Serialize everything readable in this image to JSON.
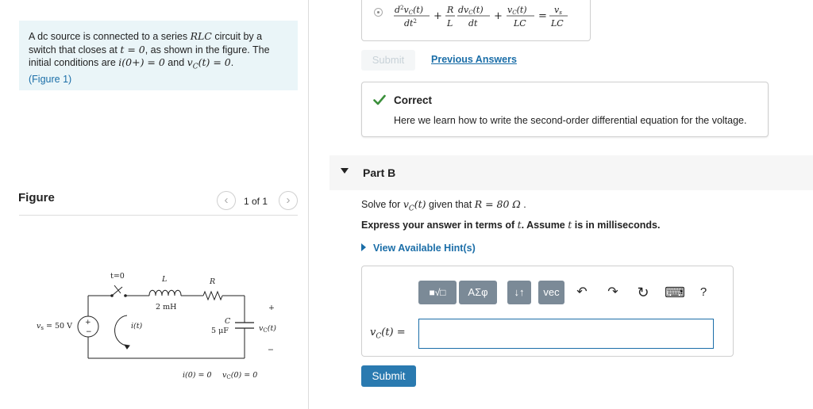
{
  "intro": {
    "line1_pre": "A dc source is connected to a series ",
    "line1_math": "RLC",
    "line1_post": " circuit by a",
    "line2_pre": "switch that closes at ",
    "line2_math": "t = 0",
    "line2_post": ", as shown in the figure. The",
    "line3_pre": "initial conditions are ",
    "line3_math1": "i(0+) = 0",
    "line3_mid": " and ",
    "line3_math2": "v",
    "line3_math2_sub": "C",
    "line3_math2_post": "(t) = 0",
    "line3_end": ".",
    "figure_link": "(Figure 1)"
  },
  "figure_panel": {
    "heading": "Figure",
    "counter": "1 of 1",
    "prev_glyph": "‹",
    "next_glyph": "›"
  },
  "circuit": {
    "switch_label": "t=0",
    "inductor_label": "L",
    "inductor_value": "2 mH",
    "resistor_label": "R",
    "capacitor_label": "C",
    "capacitor_value": "5 μF",
    "source_label": "v",
    "source_sub": "s",
    "source_value": " = 50 V",
    "current_label": "i(t)",
    "vc_label": "v",
    "vc_sub": "C",
    "vc_post": "(t)",
    "plus": "+",
    "minus": "−",
    "ic_text": "i(0) = 0",
    "vc0_pre": "v",
    "vc0_sub": "C",
    "vc0_post": "(0) = 0"
  },
  "previous_answer": {
    "eq_d2": "d",
    "eq_d2_exp": "2",
    "eq_vc": "v",
    "eq_vc_sub": "C",
    "eq_t": "(t)",
    "eq_dt2": "dt",
    "eq_dt2_exp": "2",
    "eq_plus": "+",
    "eq_R": "R",
    "eq_L": "L",
    "eq_dvc": "dv",
    "eq_dt": "dt",
    "eq_LC": "LC",
    "eq_eq": "=",
    "eq_vs": "v",
    "eq_vs_sub": "s"
  },
  "submit_disabled_label": "Submit",
  "previous_answers_label": "Previous Answers",
  "feedback": {
    "title": "Correct",
    "message": "Here we learn how to write the second-order differential equation for the voltage."
  },
  "part_b": {
    "title": "Part B",
    "solve_pre": "Solve for ",
    "solve_var": "v",
    "solve_var_sub": "C",
    "solve_var_post": "(t)",
    "solve_mid": " given that ",
    "solve_math": "R = 80 Ω",
    "solve_end": " .",
    "express_pre": "Express your answer in terms of ",
    "express_math": "t",
    "express_mid": ". Assume ",
    "express_math2": "t",
    "express_post": " is in milliseconds.",
    "hint_label": "View Available Hint(s)"
  },
  "toolbar": {
    "templates_glyph": "■√□",
    "greek_label": "ΑΣφ",
    "arrows_glyph": "↓↑",
    "vec_label": "vec",
    "undo_glyph": "↶",
    "redo_glyph": "↷",
    "reset_glyph": "↻",
    "keyboard_glyph": "⌨",
    "help_glyph": "?"
  },
  "answer": {
    "label_var": "v",
    "label_sub": "C",
    "label_post": "(t) =",
    "value": "",
    "placeholder": ""
  },
  "submit_label": "Submit",
  "colors": {
    "accent": "#1b6ea8",
    "correct_green": "#3b8f3b",
    "toolbar_gray": "#7b8a97",
    "intro_bg": "#eaf5f8",
    "submit_blue": "#2a7ab0"
  }
}
